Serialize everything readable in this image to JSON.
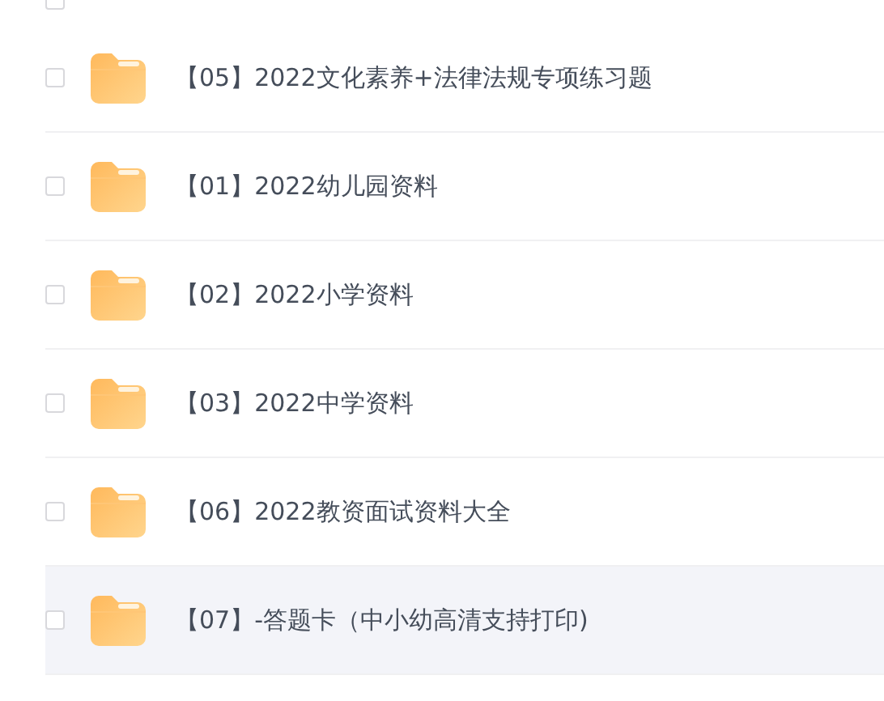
{
  "header": {
    "checked": false
  },
  "files": [
    {
      "name": "【05】2022文化素养+法律法规专项练习题",
      "checked": false,
      "highlighted": false
    },
    {
      "name": "【01】2022幼儿园资料",
      "checked": false,
      "highlighted": false
    },
    {
      "name": "【02】2022小学资料",
      "checked": false,
      "highlighted": false
    },
    {
      "name": "【03】2022中学资料",
      "checked": false,
      "highlighted": false
    },
    {
      "name": "【06】2022教资面试资料大全",
      "checked": false,
      "highlighted": false
    },
    {
      "name": "【07】-答题卡（中小幼高清支持打印)",
      "checked": false,
      "highlighted": true
    }
  ]
}
